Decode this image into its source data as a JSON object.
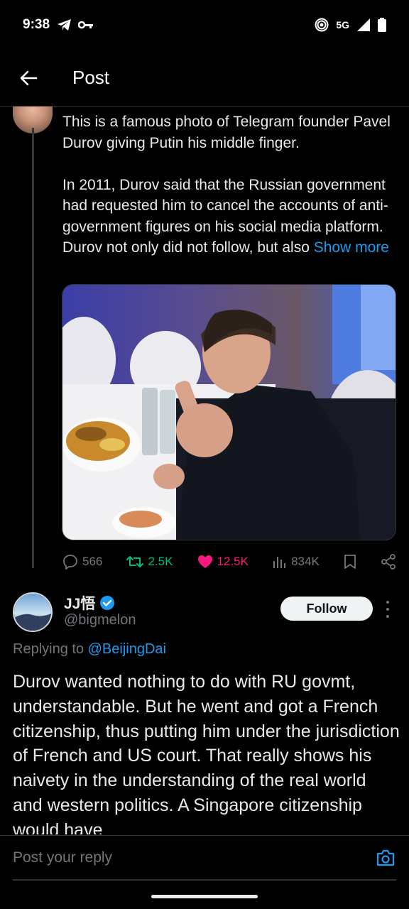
{
  "status_bar": {
    "time": "9:38",
    "network": "5G",
    "icons": [
      "telegram-icon",
      "key-icon",
      "hotspot-icon",
      "signal-icon",
      "battery-icon"
    ]
  },
  "header": {
    "title": "Post",
    "back_icon": "arrow-left-icon"
  },
  "tweet": {
    "text": "This is a famous photo of Telegram founder Pavel Durov giving Putin his middle finger.\n\nIn 2011, Durov said that the Russian government had requested him to cancel the accounts of anti-government figures on his social media platform. Durov not only did not follow, but also ",
    "show_more": "Show more",
    "stats": {
      "replies": "566",
      "reposts": "2.5K",
      "likes": "12.5K",
      "views": "834K"
    }
  },
  "reply": {
    "display_name": "JJ悟",
    "handle": "@bigmelon",
    "follow_label": "Follow",
    "replying_prefix": "Replying to",
    "replying_to": "@BeijingDai",
    "text": "Durov wanted nothing to do with RU govmt, understandable. But he went and got a French citizenship, thus putting him under the jurisdiction of French and US court. That really shows his naivety in the understanding of the real world and western politics. A Singapore citizenship would have"
  },
  "composer": {
    "placeholder": "Post your reply"
  },
  "colors": {
    "background": "#000000",
    "accent": "#1d9bf0",
    "like": "#f91880",
    "repost": "#00ba7c",
    "muted": "#71767b"
  }
}
